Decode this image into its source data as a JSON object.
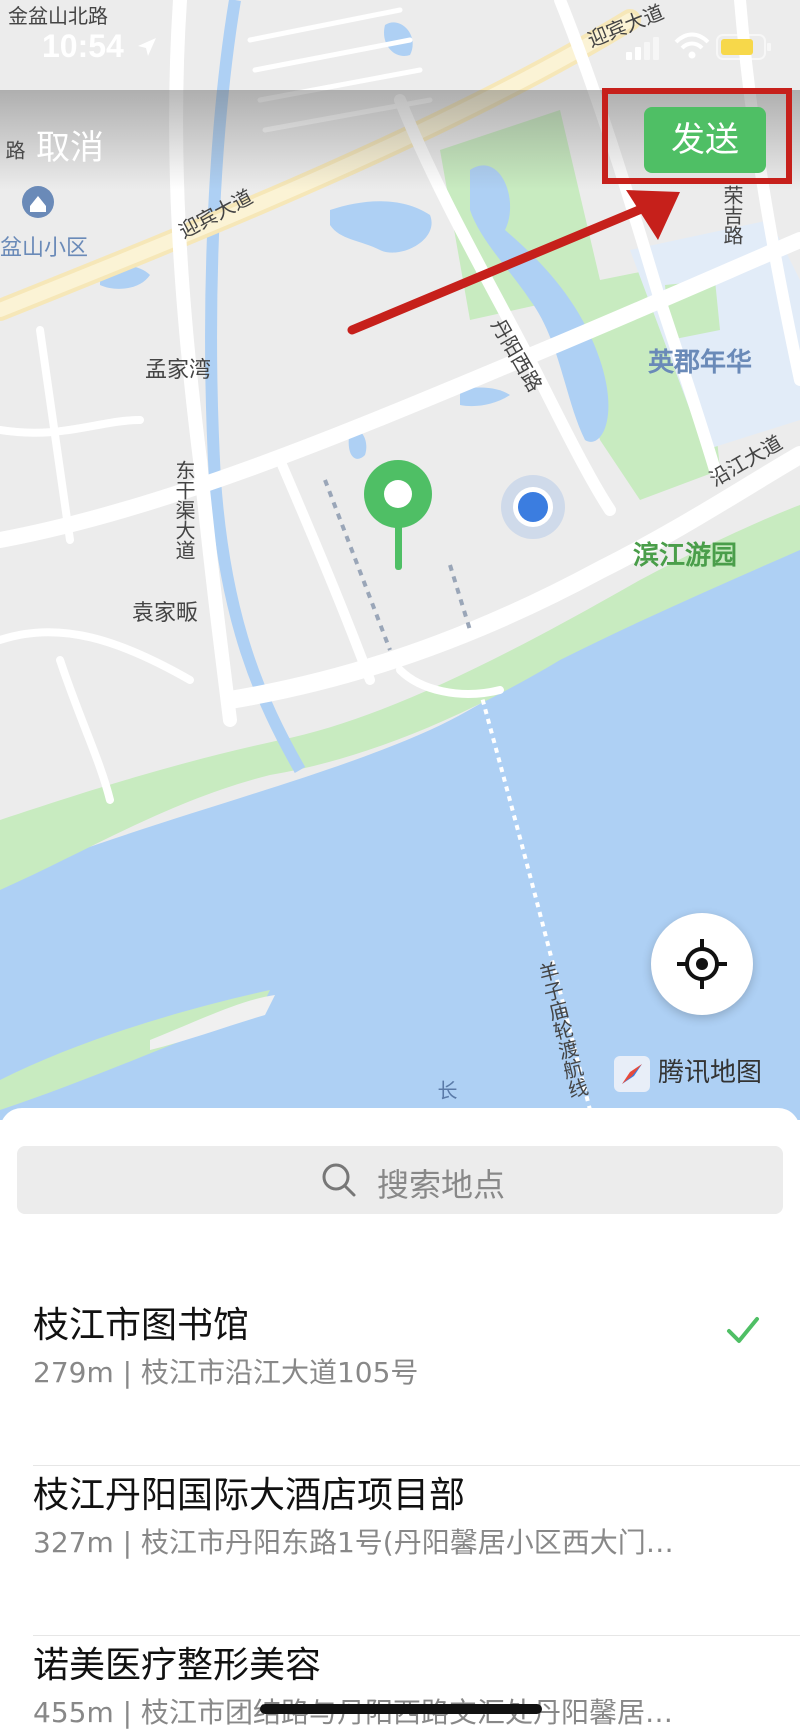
{
  "status_bar": {
    "time": "10:54"
  },
  "header": {
    "cancel_label": "取消",
    "send_label": "发送"
  },
  "map": {
    "provider": "腾讯地图",
    "labels": {
      "jinpen_north": "金盆山北路",
      "yingbin_top": "迎宾大道",
      "yingbin_mid": "迎宾大道",
      "penshan": "盆山小区",
      "mengjiawan": "孟家湾",
      "danyang_west": "丹阳西路",
      "yingjun": "英郡年华",
      "dongganqu": "东干渠大道",
      "yanjiang": "沿江大道",
      "binjiang": "滨江游园",
      "yuanjiafan": "袁家畈",
      "ferry": "羊子庙轮渡航线",
      "changjiang": "长",
      "rongji": "荣吉路",
      "left_road": "路"
    }
  },
  "search": {
    "placeholder": "搜索地点"
  },
  "results": [
    {
      "title": "枝江市图书馆",
      "subtitle": "279m | 枝江市沿江大道105号",
      "selected": true
    },
    {
      "title": "枝江丹阳国际大酒店项目部",
      "subtitle": "327m | 枝江市丹阳东路1号(丹阳馨居小区西大门…",
      "selected": false
    },
    {
      "title": "诺美医疗整形美容",
      "subtitle": "455m | 枝江市团结路与丹阳西路交汇处丹阳馨居…",
      "selected": false
    }
  ],
  "colors": {
    "accent": "#4fbf65",
    "annotation": "#c6201b",
    "water": "#aed0f4",
    "park": "#c8ebc0"
  }
}
